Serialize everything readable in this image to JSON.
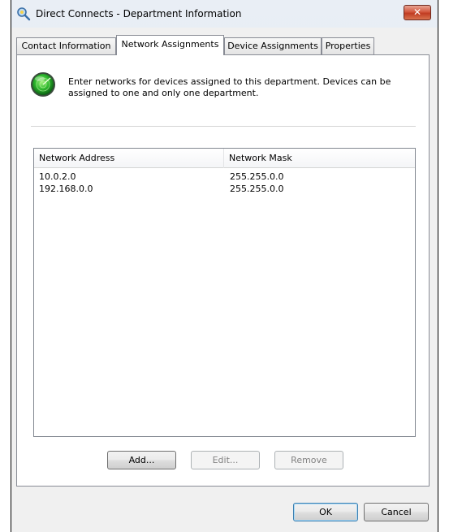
{
  "window": {
    "title": "Direct Connects - Department Information",
    "close_glyph": "✕"
  },
  "tabs": [
    {
      "label": "Contact Information",
      "active": false
    },
    {
      "label": "Network Assignments",
      "active": true
    },
    {
      "label": "Device Assignments",
      "active": false
    },
    {
      "label": "Properties",
      "active": false
    }
  ],
  "network_page": {
    "icon": "radar-icon",
    "description": "Enter networks for devices assigned to this department.  Devices can be assigned to one and only one department.",
    "columns": [
      "Network Address",
      "Network Mask"
    ],
    "rows": [
      {
        "address": "10.0.2.0",
        "mask": "255.255.0.0"
      },
      {
        "address": "192.168.0.0",
        "mask": "255.255.0.0"
      }
    ],
    "buttons": {
      "add": "Add...",
      "edit": "Edit...",
      "remove": "Remove"
    }
  },
  "dialog_buttons": {
    "ok": "OK",
    "cancel": "Cancel"
  },
  "colors": {
    "close_button": "#c03c22",
    "radar_green": "#2eb82e",
    "window_frame": "#dfe6ef"
  }
}
